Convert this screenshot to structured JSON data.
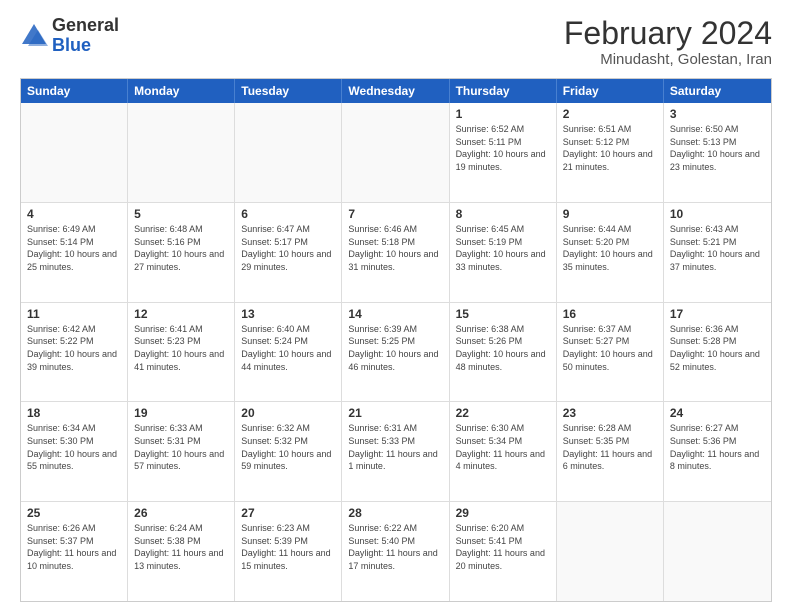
{
  "logo": {
    "general": "General",
    "blue": "Blue"
  },
  "title": {
    "month_year": "February 2024",
    "location": "Minudasht, Golestan, Iran"
  },
  "days_of_week": [
    "Sunday",
    "Monday",
    "Tuesday",
    "Wednesday",
    "Thursday",
    "Friday",
    "Saturday"
  ],
  "weeks": [
    [
      {
        "day": "",
        "info": ""
      },
      {
        "day": "",
        "info": ""
      },
      {
        "day": "",
        "info": ""
      },
      {
        "day": "",
        "info": ""
      },
      {
        "day": "1",
        "info": "Sunrise: 6:52 AM\nSunset: 5:11 PM\nDaylight: 10 hours and 19 minutes."
      },
      {
        "day": "2",
        "info": "Sunrise: 6:51 AM\nSunset: 5:12 PM\nDaylight: 10 hours and 21 minutes."
      },
      {
        "day": "3",
        "info": "Sunrise: 6:50 AM\nSunset: 5:13 PM\nDaylight: 10 hours and 23 minutes."
      }
    ],
    [
      {
        "day": "4",
        "info": "Sunrise: 6:49 AM\nSunset: 5:14 PM\nDaylight: 10 hours and 25 minutes."
      },
      {
        "day": "5",
        "info": "Sunrise: 6:48 AM\nSunset: 5:16 PM\nDaylight: 10 hours and 27 minutes."
      },
      {
        "day": "6",
        "info": "Sunrise: 6:47 AM\nSunset: 5:17 PM\nDaylight: 10 hours and 29 minutes."
      },
      {
        "day": "7",
        "info": "Sunrise: 6:46 AM\nSunset: 5:18 PM\nDaylight: 10 hours and 31 minutes."
      },
      {
        "day": "8",
        "info": "Sunrise: 6:45 AM\nSunset: 5:19 PM\nDaylight: 10 hours and 33 minutes."
      },
      {
        "day": "9",
        "info": "Sunrise: 6:44 AM\nSunset: 5:20 PM\nDaylight: 10 hours and 35 minutes."
      },
      {
        "day": "10",
        "info": "Sunrise: 6:43 AM\nSunset: 5:21 PM\nDaylight: 10 hours and 37 minutes."
      }
    ],
    [
      {
        "day": "11",
        "info": "Sunrise: 6:42 AM\nSunset: 5:22 PM\nDaylight: 10 hours and 39 minutes."
      },
      {
        "day": "12",
        "info": "Sunrise: 6:41 AM\nSunset: 5:23 PM\nDaylight: 10 hours and 41 minutes."
      },
      {
        "day": "13",
        "info": "Sunrise: 6:40 AM\nSunset: 5:24 PM\nDaylight: 10 hours and 44 minutes."
      },
      {
        "day": "14",
        "info": "Sunrise: 6:39 AM\nSunset: 5:25 PM\nDaylight: 10 hours and 46 minutes."
      },
      {
        "day": "15",
        "info": "Sunrise: 6:38 AM\nSunset: 5:26 PM\nDaylight: 10 hours and 48 minutes."
      },
      {
        "day": "16",
        "info": "Sunrise: 6:37 AM\nSunset: 5:27 PM\nDaylight: 10 hours and 50 minutes."
      },
      {
        "day": "17",
        "info": "Sunrise: 6:36 AM\nSunset: 5:28 PM\nDaylight: 10 hours and 52 minutes."
      }
    ],
    [
      {
        "day": "18",
        "info": "Sunrise: 6:34 AM\nSunset: 5:30 PM\nDaylight: 10 hours and 55 minutes."
      },
      {
        "day": "19",
        "info": "Sunrise: 6:33 AM\nSunset: 5:31 PM\nDaylight: 10 hours and 57 minutes."
      },
      {
        "day": "20",
        "info": "Sunrise: 6:32 AM\nSunset: 5:32 PM\nDaylight: 10 hours and 59 minutes."
      },
      {
        "day": "21",
        "info": "Sunrise: 6:31 AM\nSunset: 5:33 PM\nDaylight: 11 hours and 1 minute."
      },
      {
        "day": "22",
        "info": "Sunrise: 6:30 AM\nSunset: 5:34 PM\nDaylight: 11 hours and 4 minutes."
      },
      {
        "day": "23",
        "info": "Sunrise: 6:28 AM\nSunset: 5:35 PM\nDaylight: 11 hours and 6 minutes."
      },
      {
        "day": "24",
        "info": "Sunrise: 6:27 AM\nSunset: 5:36 PM\nDaylight: 11 hours and 8 minutes."
      }
    ],
    [
      {
        "day": "25",
        "info": "Sunrise: 6:26 AM\nSunset: 5:37 PM\nDaylight: 11 hours and 10 minutes."
      },
      {
        "day": "26",
        "info": "Sunrise: 6:24 AM\nSunset: 5:38 PM\nDaylight: 11 hours and 13 minutes."
      },
      {
        "day": "27",
        "info": "Sunrise: 6:23 AM\nSunset: 5:39 PM\nDaylight: 11 hours and 15 minutes."
      },
      {
        "day": "28",
        "info": "Sunrise: 6:22 AM\nSunset: 5:40 PM\nDaylight: 11 hours and 17 minutes."
      },
      {
        "day": "29",
        "info": "Sunrise: 6:20 AM\nSunset: 5:41 PM\nDaylight: 11 hours and 20 minutes."
      },
      {
        "day": "",
        "info": ""
      },
      {
        "day": "",
        "info": ""
      }
    ]
  ]
}
